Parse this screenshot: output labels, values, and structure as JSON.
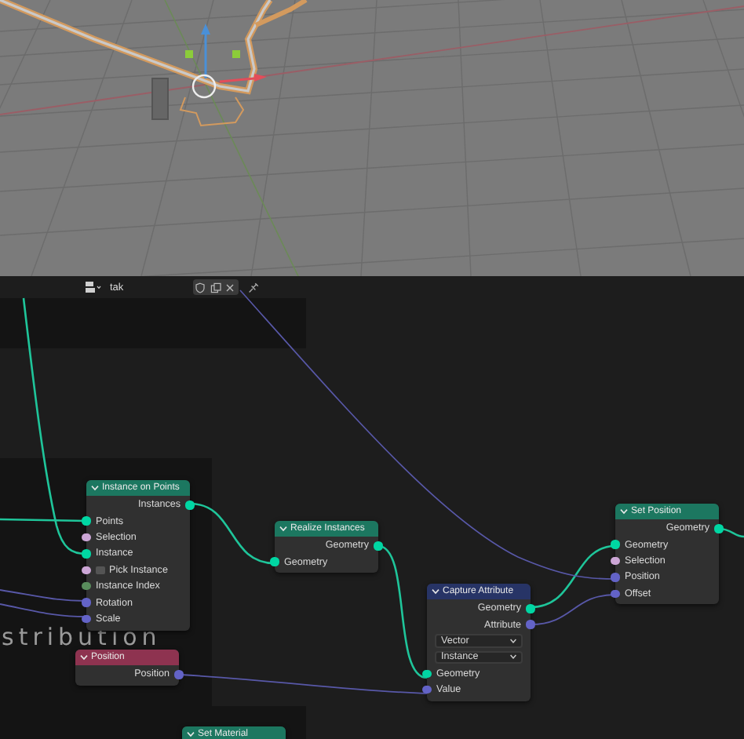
{
  "header": {
    "name_value": "tak"
  },
  "annotation": "stribution",
  "nodes": [
    {
      "title": "Instance on Points",
      "color": "#1c7760",
      "rows": [
        {
          "kind": "socket",
          "label": "Instances",
          "output": true,
          "color": "#00d6a3"
        },
        {
          "kind": "socket",
          "label": "Points",
          "output": false,
          "color": "#00d6a3"
        },
        {
          "kind": "socket",
          "label": "Selection",
          "output": false,
          "color": "#cca6d6"
        },
        {
          "kind": "socket",
          "label": "Instance",
          "output": false,
          "color": "#00d6a3"
        },
        {
          "kind": "checkbox",
          "label": "Pick Instance",
          "output": false,
          "color": "#cca6d6",
          "checked": false
        },
        {
          "kind": "socket",
          "label": "Instance Index",
          "output": false,
          "color": "#598c5c"
        },
        {
          "kind": "socket",
          "label": "Rotation",
          "output": false,
          "color": "#6363c7"
        },
        {
          "kind": "socket",
          "label": "Scale",
          "output": false,
          "color": "#6363c7"
        }
      ]
    },
    {
      "title": "Position",
      "color": "#8e3350",
      "rows": [
        {
          "kind": "socket",
          "label": "Position",
          "output": true,
          "color": "#6363c7"
        }
      ]
    },
    {
      "title": "Realize Instances",
      "color": "#1c7760",
      "rows": [
        {
          "kind": "socket",
          "label": "Geometry",
          "output": true,
          "color": "#00d6a3"
        },
        {
          "kind": "socket",
          "label": "Geometry",
          "output": false,
          "color": "#00d6a3"
        }
      ]
    },
    {
      "title": "Capture Attribute",
      "color": "#273466",
      "rows": [
        {
          "kind": "socket",
          "label": "Geometry",
          "output": true,
          "color": "#00d6a3"
        },
        {
          "kind": "socket",
          "label": "Attribute",
          "output": true,
          "color": "#6363c7"
        },
        {
          "kind": "dropdown",
          "label": "Vector"
        },
        {
          "kind": "dropdown",
          "label": "Instance"
        },
        {
          "kind": "socket",
          "label": "Geometry",
          "output": false,
          "color": "#00d6a3"
        },
        {
          "kind": "socket",
          "label": "Value",
          "output": false,
          "color": "#6363c7"
        }
      ]
    },
    {
      "title": "Set Position",
      "color": "#1c7760",
      "rows": [
        {
          "kind": "socket",
          "label": "Geometry",
          "output": true,
          "color": "#00d6a3"
        },
        {
          "kind": "socket",
          "label": "Geometry",
          "output": false,
          "color": "#00d6a3"
        },
        {
          "kind": "socket",
          "label": "Selection",
          "output": false,
          "color": "#cca6d6"
        },
        {
          "kind": "socket",
          "label": "Position",
          "output": false,
          "color": "#6363c7"
        },
        {
          "kind": "socket",
          "label": "Offset",
          "output": false,
          "color": "#6363c7"
        }
      ]
    },
    {
      "title": "Set Material",
      "color": "#1c7760"
    }
  ]
}
